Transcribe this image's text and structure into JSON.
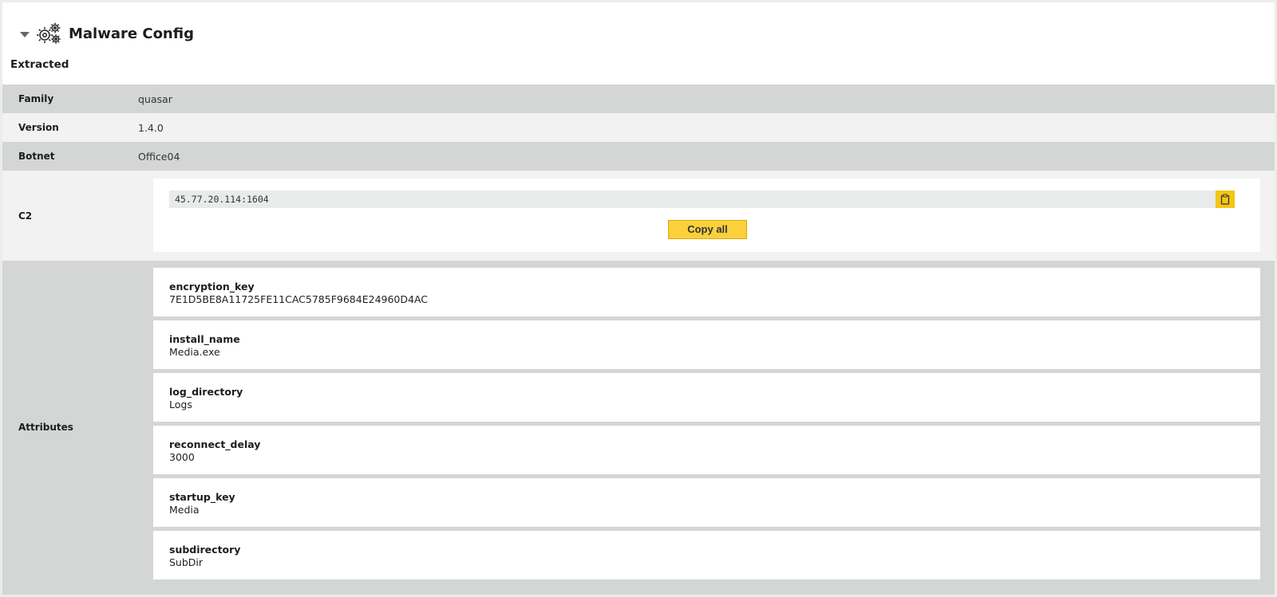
{
  "header": {
    "title": "Malware Config",
    "subtitle": "Extracted",
    "caret_icon": "caret-down-icon",
    "gears_icon": "gears-icon"
  },
  "rows": {
    "family": {
      "label": "Family",
      "value": "quasar"
    },
    "version": {
      "label": "Version",
      "value": "1.4.0"
    },
    "botnet": {
      "label": "Botnet",
      "value": "Office04"
    }
  },
  "c2": {
    "label": "C2",
    "values": [
      "45.77.20.114:1604"
    ],
    "copy_all_label": "Copy all",
    "copy_icon": "clipboard-icon"
  },
  "attributes": {
    "label": "Attributes",
    "items": [
      {
        "name": "encryption_key",
        "value": "7E1D5BE8A11725FE11CAC5785F9684E24960D4AC"
      },
      {
        "name": "install_name",
        "value": "Media.exe"
      },
      {
        "name": "log_directory",
        "value": "Logs"
      },
      {
        "name": "reconnect_delay",
        "value": "3000"
      },
      {
        "name": "startup_key",
        "value": "Media"
      },
      {
        "name": "subdirectory",
        "value": "SubDir"
      }
    ]
  },
  "colors": {
    "accent": "#f5c517",
    "row_dark": "#d4d6d6",
    "row_light": "#f2f2f2"
  }
}
